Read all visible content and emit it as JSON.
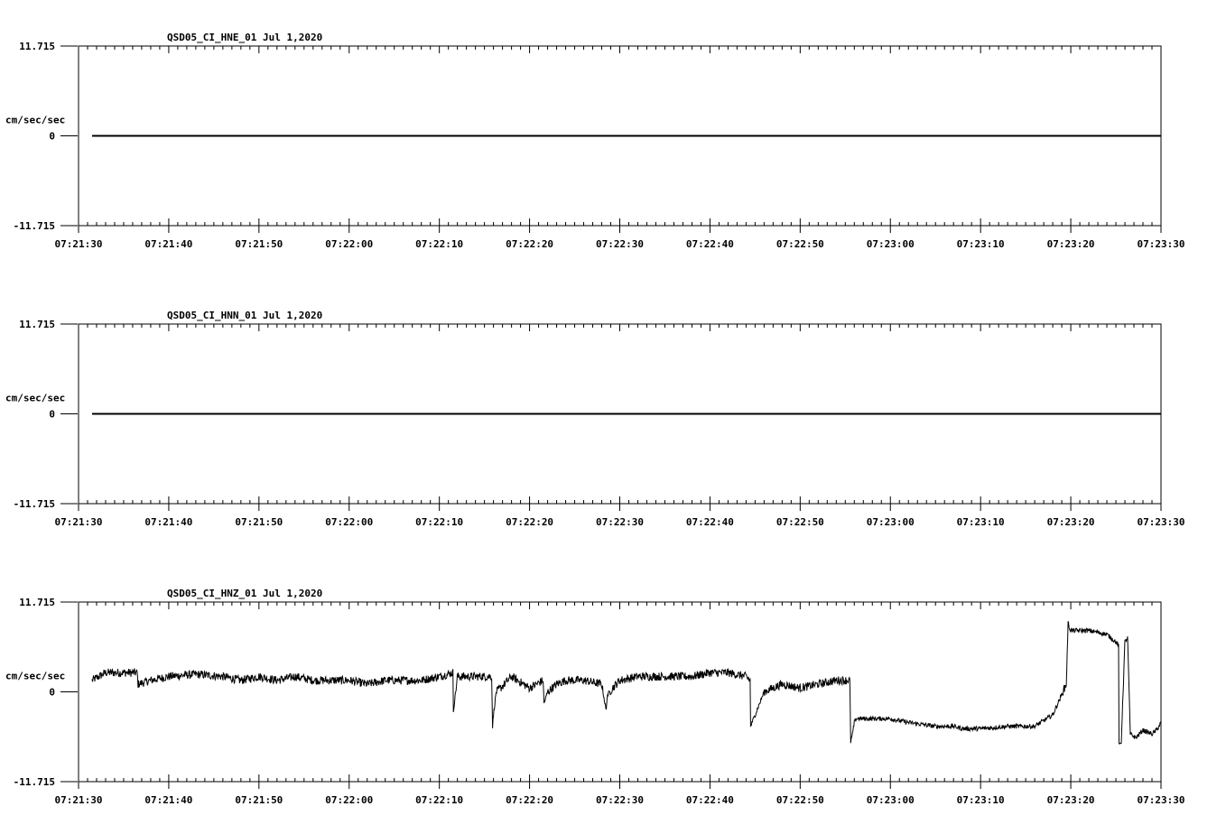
{
  "chart_data": [
    {
      "type": "line",
      "title": "QSD05_CI_HNE_01  Jul 1,2020",
      "ylabel": "cm/sec/sec",
      "ylim": [
        -11.715,
        11.715
      ],
      "ytick_labels": [
        "11.715",
        "0",
        "-11.715"
      ],
      "x_tick_labels": [
        "07:21:30",
        "07:21:40",
        "07:21:50",
        "07:22:00",
        "07:22:10",
        "07:22:20",
        "07:22:30",
        "07:22:40",
        "07:22:50",
        "07:23:00",
        "07:23:10",
        "07:23:20",
        "07:23:30"
      ],
      "xlim_seconds": [
        0,
        120
      ],
      "grid": false,
      "series": [
        {
          "x": [
            1.5,
            120
          ],
          "y": [
            0,
            0
          ]
        }
      ]
    },
    {
      "type": "line",
      "title": "QSD05_CI_HNN_01  Jul 1,2020",
      "ylabel": "cm/sec/sec",
      "ylim": [
        -11.715,
        11.715
      ],
      "ytick_labels": [
        "11.715",
        "0",
        "-11.715"
      ],
      "x_tick_labels": [
        "07:21:30",
        "07:21:40",
        "07:21:50",
        "07:22:00",
        "07:22:10",
        "07:22:20",
        "07:22:30",
        "07:22:40",
        "07:22:50",
        "07:23:00",
        "07:23:10",
        "07:23:20",
        "07:23:30"
      ],
      "xlim_seconds": [
        0,
        120
      ],
      "grid": false,
      "series": [
        {
          "x": [
            1.5,
            120
          ],
          "y": [
            0,
            0
          ]
        }
      ]
    },
    {
      "type": "line",
      "title": "QSD05_CI_HNZ_01  Jul 1,2020",
      "ylabel": "cm/sec/sec",
      "ylim": [
        -11.715,
        11.715
      ],
      "ytick_labels": [
        "11.715",
        "0",
        "-11.715"
      ],
      "x_tick_labels": [
        "07:21:30",
        "07:21:40",
        "07:21:50",
        "07:22:00",
        "07:22:10",
        "07:22:20",
        "07:22:30",
        "07:22:40",
        "07:22:50",
        "07:23:00",
        "07:23:10",
        "07:23:20",
        "07:23:30"
      ],
      "xlim_seconds": [
        0,
        120
      ],
      "grid": false,
      "series": [
        {
          "x": [
            1.5,
            3,
            5,
            6.5,
            6.6,
            8,
            10,
            13,
            16,
            18,
            20,
            22,
            24,
            26,
            28,
            30,
            32,
            34,
            36,
            38,
            40,
            41.5,
            41.55,
            42,
            42.5,
            45.8,
            45.9,
            46,
            46.3,
            46.8,
            48,
            50,
            51.5,
            51.6,
            52,
            53,
            54,
            56,
            58,
            58.5,
            58.6,
            59.2,
            60,
            62,
            64,
            66,
            68,
            70,
            72,
            74,
            74.45,
            74.5,
            75,
            76,
            78,
            80,
            82,
            84,
            85.5,
            85.6,
            85.8,
            86,
            86.2,
            87,
            90,
            92,
            95,
            97,
            98,
            99,
            100,
            103,
            106,
            108,
            109.5,
            109.7,
            109.8,
            110,
            112,
            114,
            115,
            115.3,
            115.35,
            115.6,
            116,
            116.3,
            116.6,
            117.2,
            118,
            119,
            119.5,
            120
          ],
          "y": [
            1.5,
            2.5,
            2.5,
            2.5,
            1.0,
            1.5,
            2.0,
            2.3,
            2.0,
            1.5,
            2.0,
            1.5,
            2.0,
            1.5,
            1.5,
            1.5,
            1.0,
            1.5,
            1.5,
            1.5,
            2.0,
            2.5,
            -2.5,
            2.0,
            2.0,
            2.0,
            -4.5,
            -3.0,
            0.0,
            0.5,
            2.0,
            0.5,
            1.5,
            -1.5,
            0.0,
            1.0,
            1.5,
            1.5,
            1.0,
            -2.5,
            -0.5,
            0.5,
            1.5,
            2.0,
            2.0,
            2.0,
            2.0,
            2.5,
            2.5,
            2.0,
            1.5,
            -4.5,
            -3.0,
            0.0,
            1.0,
            0.5,
            1.0,
            1.5,
            1.5,
            -6.5,
            -5.5,
            -4.0,
            -3.5,
            -3.5,
            -3.5,
            -4.0,
            -4.5,
            -4.5,
            -4.8,
            -4.8,
            -4.8,
            -4.5,
            -4.5,
            -3.0,
            1.0,
            9.0,
            8.5,
            8.0,
            8.0,
            7.5,
            6.5,
            6.0,
            -7.0,
            -6.5,
            6.5,
            7.0,
            -5.5,
            -6.0,
            -5.0,
            -5.5,
            -5.0,
            -4.0
          ]
        }
      ]
    }
  ]
}
